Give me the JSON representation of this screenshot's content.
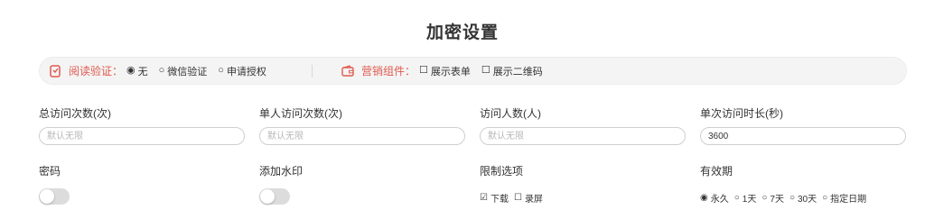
{
  "page_title": "加密设置",
  "option_bar": {
    "read_verify": {
      "label": "阅读验证：",
      "icon": "phone-shield-icon",
      "options": [
        {
          "label": "无",
          "selected": true
        },
        {
          "label": "微信验证",
          "selected": false
        },
        {
          "label": "申请授权",
          "selected": false
        }
      ]
    },
    "marketing": {
      "label": "营销组件：",
      "icon": "wallet-icon",
      "options": [
        {
          "label": "展示表单",
          "checked": false
        },
        {
          "label": "展示二维码",
          "checked": false
        }
      ]
    }
  },
  "fields": {
    "total_visits": {
      "label": "总访问次数(次)",
      "value": "",
      "placeholder": "默认无限"
    },
    "per_user_visits": {
      "label": "单人访问次数(次)",
      "value": "",
      "placeholder": "默认无限"
    },
    "visitor_count": {
      "label": "访问人数(人)",
      "value": "",
      "placeholder": "默认无限"
    },
    "visit_duration": {
      "label": "单次访问时长(秒)",
      "value": "3600",
      "placeholder": ""
    }
  },
  "settings": {
    "password": {
      "label": "密码",
      "enabled": false
    },
    "watermark": {
      "label": "添加水印",
      "enabled": false
    },
    "restrictions": {
      "label": "限制选项",
      "options": [
        {
          "label": "下载",
          "checked": true
        },
        {
          "label": "录屏",
          "checked": false
        }
      ]
    },
    "validity": {
      "label": "有效期",
      "options": [
        {
          "label": "永久",
          "selected": true
        },
        {
          "label": "1天",
          "selected": false
        },
        {
          "label": "7天",
          "selected": false
        },
        {
          "label": "30天",
          "selected": false
        },
        {
          "label": "指定日期",
          "selected": false
        }
      ]
    }
  },
  "colors": {
    "accent_red": "#e05a4f",
    "toggle_off": "#dcdcdc"
  }
}
